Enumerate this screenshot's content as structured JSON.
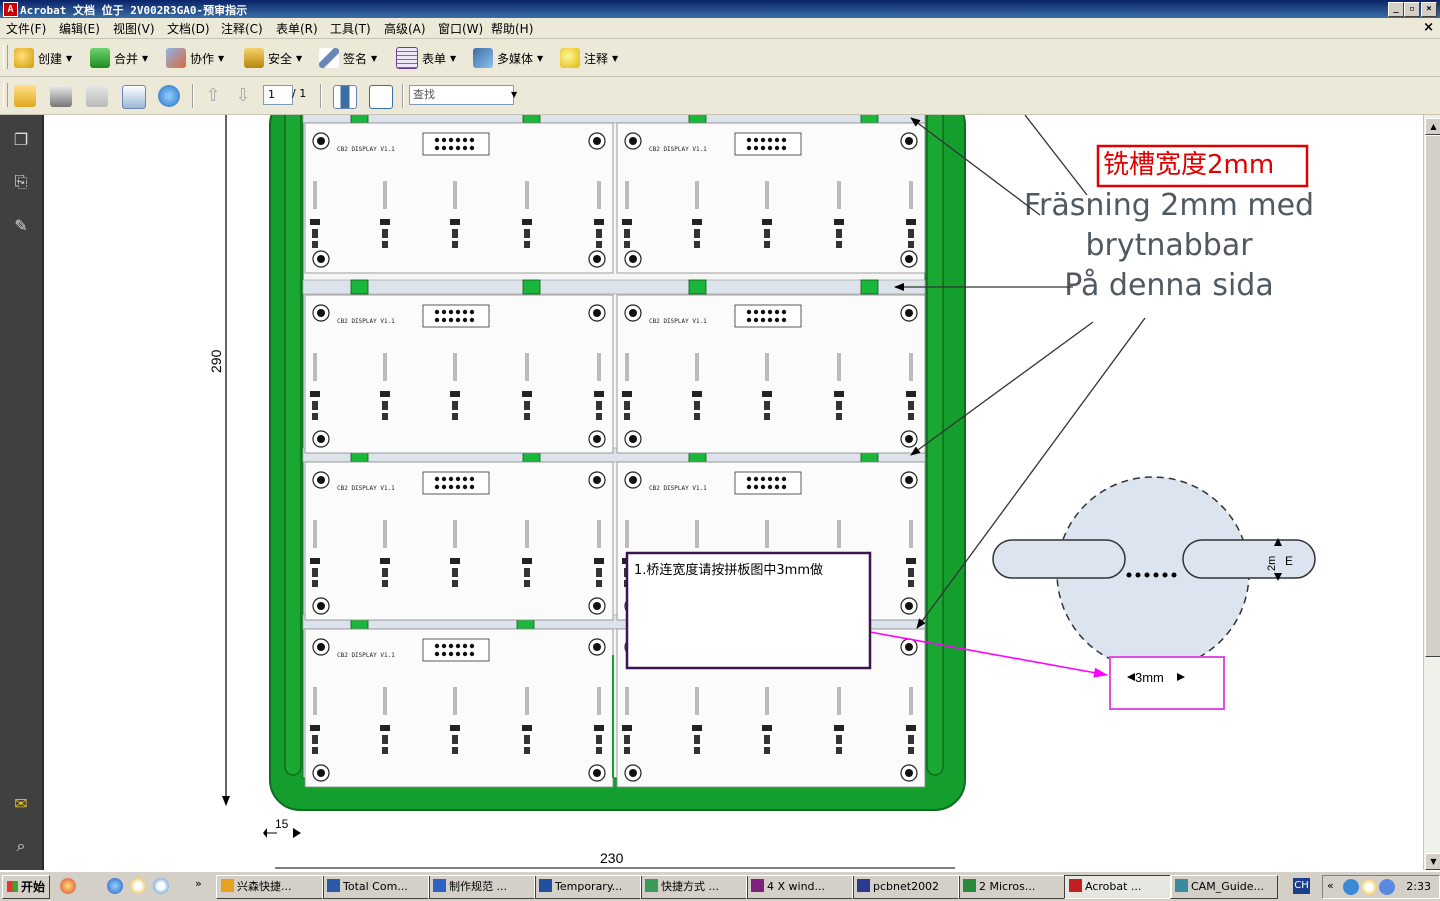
{
  "window": {
    "title": "Acrobat 文档 位于 2V002R3GA0-预审指示",
    "app_icon": "acrobat-icon",
    "buttons": [
      "minimize",
      "restore",
      "close"
    ]
  },
  "menu": {
    "items": [
      "文件(F)",
      "编辑(E)",
      "视图(V)",
      "文档(D)",
      "注释(C)",
      "表单(R)",
      "工具(T)",
      "高级(A)",
      "窗口(W)",
      "帮助(H)"
    ],
    "close_glyph": "×"
  },
  "toolbar1": {
    "buttons": [
      {
        "label": "创建",
        "icon": "create-icon"
      },
      {
        "label": "合并",
        "icon": "combine-icon"
      },
      {
        "label": "协作",
        "icon": "collaborate-icon"
      },
      {
        "label": "安全",
        "icon": "lock-icon"
      },
      {
        "label": "签名",
        "icon": "pen-icon"
      },
      {
        "label": "表单",
        "icon": "form-icon"
      },
      {
        "label": "多媒体",
        "icon": "multimedia-icon"
      },
      {
        "label": "注释",
        "icon": "comment-icon"
      }
    ]
  },
  "toolbar2": {
    "page_current": "1",
    "page_total": "/ 1",
    "find_placeholder": "查找"
  },
  "document": {
    "annotation_red": "铣槽宽度2mm",
    "swedish_line1": "Fräsning 2mm med",
    "swedish_line2": "brytnabbar",
    "swedish_line3": "På denna sida",
    "note_text": "1.桥连宽度请按拼板图中3mm做",
    "dim_3mm": "3mm",
    "dim_2mm": "2m",
    "dim_e": "E",
    "dim_290": "290",
    "dim_15": "15",
    "dim_230": "230",
    "board_label": "CB2 DISPLAY V1.1",
    "panel_rows": 4,
    "panel_cols": 2
  },
  "taskbar": {
    "start": "开始",
    "tasks": [
      {
        "label": "兴森快捷...",
        "active": false
      },
      {
        "label": "Total Com...",
        "active": false
      },
      {
        "label": "制作规范 ...",
        "active": false
      },
      {
        "label": "Temporary...",
        "active": false
      },
      {
        "label": "快捷方式 ...",
        "active": false
      },
      {
        "label": "4 X wind...",
        "active": false
      },
      {
        "label": "pcbnet2002",
        "active": false
      },
      {
        "label": "2 Micros...",
        "active": false
      },
      {
        "label": "Acrobat ...",
        "active": true
      },
      {
        "label": "CAM_Guide...",
        "active": false
      }
    ],
    "lang": "CH",
    "clock": "2:33"
  },
  "colors": {
    "titlebar": "#0a246a",
    "board_green": "#149e2e",
    "annotation_red": "#e00000",
    "note_border": "#3a1550",
    "arrow_magenta": "#ff00ff"
  }
}
